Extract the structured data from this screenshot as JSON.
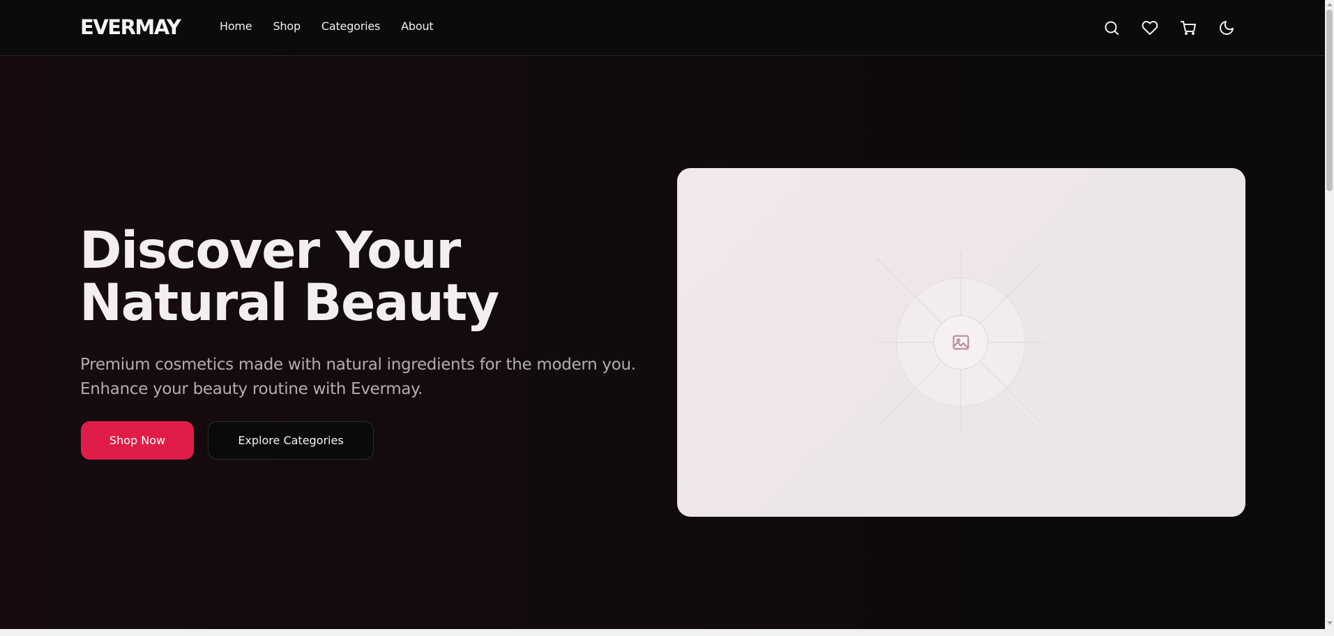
{
  "brand": {
    "logo": "EVERMAY"
  },
  "nav": {
    "items": [
      {
        "label": "Home"
      },
      {
        "label": "Shop"
      },
      {
        "label": "Categories"
      },
      {
        "label": "About"
      }
    ]
  },
  "header_icons": [
    "search-icon",
    "heart-icon",
    "cart-icon",
    "moon-icon"
  ],
  "hero": {
    "title": "Discover Your Natural Beauty",
    "subtitle": "Premium cosmetics made with natural ingredients for the modern you. Enhance your beauty routine with Evermay.",
    "primary_button": "Shop Now",
    "secondary_button": "Explore Categories",
    "image_icon": "image-icon"
  },
  "colors": {
    "accent": "#e01d48",
    "header_bg": "#0b0b0b",
    "page_bg": "#120b0d",
    "image_card_bg": "#efe7e9"
  }
}
